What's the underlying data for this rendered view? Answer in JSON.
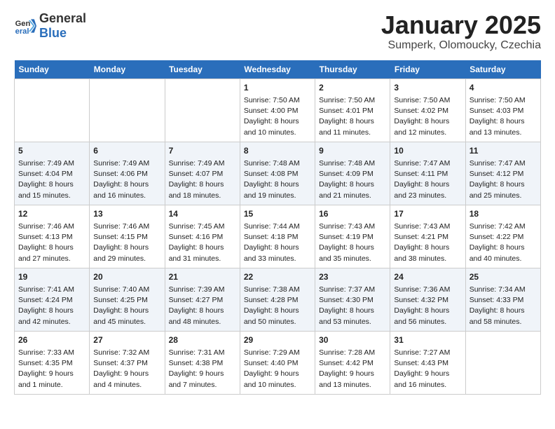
{
  "header": {
    "logo_general": "General",
    "logo_blue": "Blue",
    "title": "January 2025",
    "subtitle": "Sumperk, Olomoucky, Czechia"
  },
  "weekdays": [
    "Sunday",
    "Monday",
    "Tuesday",
    "Wednesday",
    "Thursday",
    "Friday",
    "Saturday"
  ],
  "weeks": [
    [
      {
        "day": "",
        "info": ""
      },
      {
        "day": "",
        "info": ""
      },
      {
        "day": "",
        "info": ""
      },
      {
        "day": "1",
        "info": "Sunrise: 7:50 AM\nSunset: 4:00 PM\nDaylight: 8 hours\nand 10 minutes."
      },
      {
        "day": "2",
        "info": "Sunrise: 7:50 AM\nSunset: 4:01 PM\nDaylight: 8 hours\nand 11 minutes."
      },
      {
        "day": "3",
        "info": "Sunrise: 7:50 AM\nSunset: 4:02 PM\nDaylight: 8 hours\nand 12 minutes."
      },
      {
        "day": "4",
        "info": "Sunrise: 7:50 AM\nSunset: 4:03 PM\nDaylight: 8 hours\nand 13 minutes."
      }
    ],
    [
      {
        "day": "5",
        "info": "Sunrise: 7:49 AM\nSunset: 4:04 PM\nDaylight: 8 hours\nand 15 minutes."
      },
      {
        "day": "6",
        "info": "Sunrise: 7:49 AM\nSunset: 4:06 PM\nDaylight: 8 hours\nand 16 minutes."
      },
      {
        "day": "7",
        "info": "Sunrise: 7:49 AM\nSunset: 4:07 PM\nDaylight: 8 hours\nand 18 minutes."
      },
      {
        "day": "8",
        "info": "Sunrise: 7:48 AM\nSunset: 4:08 PM\nDaylight: 8 hours\nand 19 minutes."
      },
      {
        "day": "9",
        "info": "Sunrise: 7:48 AM\nSunset: 4:09 PM\nDaylight: 8 hours\nand 21 minutes."
      },
      {
        "day": "10",
        "info": "Sunrise: 7:47 AM\nSunset: 4:11 PM\nDaylight: 8 hours\nand 23 minutes."
      },
      {
        "day": "11",
        "info": "Sunrise: 7:47 AM\nSunset: 4:12 PM\nDaylight: 8 hours\nand 25 minutes."
      }
    ],
    [
      {
        "day": "12",
        "info": "Sunrise: 7:46 AM\nSunset: 4:13 PM\nDaylight: 8 hours\nand 27 minutes."
      },
      {
        "day": "13",
        "info": "Sunrise: 7:46 AM\nSunset: 4:15 PM\nDaylight: 8 hours\nand 29 minutes."
      },
      {
        "day": "14",
        "info": "Sunrise: 7:45 AM\nSunset: 4:16 PM\nDaylight: 8 hours\nand 31 minutes."
      },
      {
        "day": "15",
        "info": "Sunrise: 7:44 AM\nSunset: 4:18 PM\nDaylight: 8 hours\nand 33 minutes."
      },
      {
        "day": "16",
        "info": "Sunrise: 7:43 AM\nSunset: 4:19 PM\nDaylight: 8 hours\nand 35 minutes."
      },
      {
        "day": "17",
        "info": "Sunrise: 7:43 AM\nSunset: 4:21 PM\nDaylight: 8 hours\nand 38 minutes."
      },
      {
        "day": "18",
        "info": "Sunrise: 7:42 AM\nSunset: 4:22 PM\nDaylight: 8 hours\nand 40 minutes."
      }
    ],
    [
      {
        "day": "19",
        "info": "Sunrise: 7:41 AM\nSunset: 4:24 PM\nDaylight: 8 hours\nand 42 minutes."
      },
      {
        "day": "20",
        "info": "Sunrise: 7:40 AM\nSunset: 4:25 PM\nDaylight: 8 hours\nand 45 minutes."
      },
      {
        "day": "21",
        "info": "Sunrise: 7:39 AM\nSunset: 4:27 PM\nDaylight: 8 hours\nand 48 minutes."
      },
      {
        "day": "22",
        "info": "Sunrise: 7:38 AM\nSunset: 4:28 PM\nDaylight: 8 hours\nand 50 minutes."
      },
      {
        "day": "23",
        "info": "Sunrise: 7:37 AM\nSunset: 4:30 PM\nDaylight: 8 hours\nand 53 minutes."
      },
      {
        "day": "24",
        "info": "Sunrise: 7:36 AM\nSunset: 4:32 PM\nDaylight: 8 hours\nand 56 minutes."
      },
      {
        "day": "25",
        "info": "Sunrise: 7:34 AM\nSunset: 4:33 PM\nDaylight: 8 hours\nand 58 minutes."
      }
    ],
    [
      {
        "day": "26",
        "info": "Sunrise: 7:33 AM\nSunset: 4:35 PM\nDaylight: 9 hours\nand 1 minute."
      },
      {
        "day": "27",
        "info": "Sunrise: 7:32 AM\nSunset: 4:37 PM\nDaylight: 9 hours\nand 4 minutes."
      },
      {
        "day": "28",
        "info": "Sunrise: 7:31 AM\nSunset: 4:38 PM\nDaylight: 9 hours\nand 7 minutes."
      },
      {
        "day": "29",
        "info": "Sunrise: 7:29 AM\nSunset: 4:40 PM\nDaylight: 9 hours\nand 10 minutes."
      },
      {
        "day": "30",
        "info": "Sunrise: 7:28 AM\nSunset: 4:42 PM\nDaylight: 9 hours\nand 13 minutes."
      },
      {
        "day": "31",
        "info": "Sunrise: 7:27 AM\nSunset: 4:43 PM\nDaylight: 9 hours\nand 16 minutes."
      },
      {
        "day": "",
        "info": ""
      }
    ]
  ]
}
